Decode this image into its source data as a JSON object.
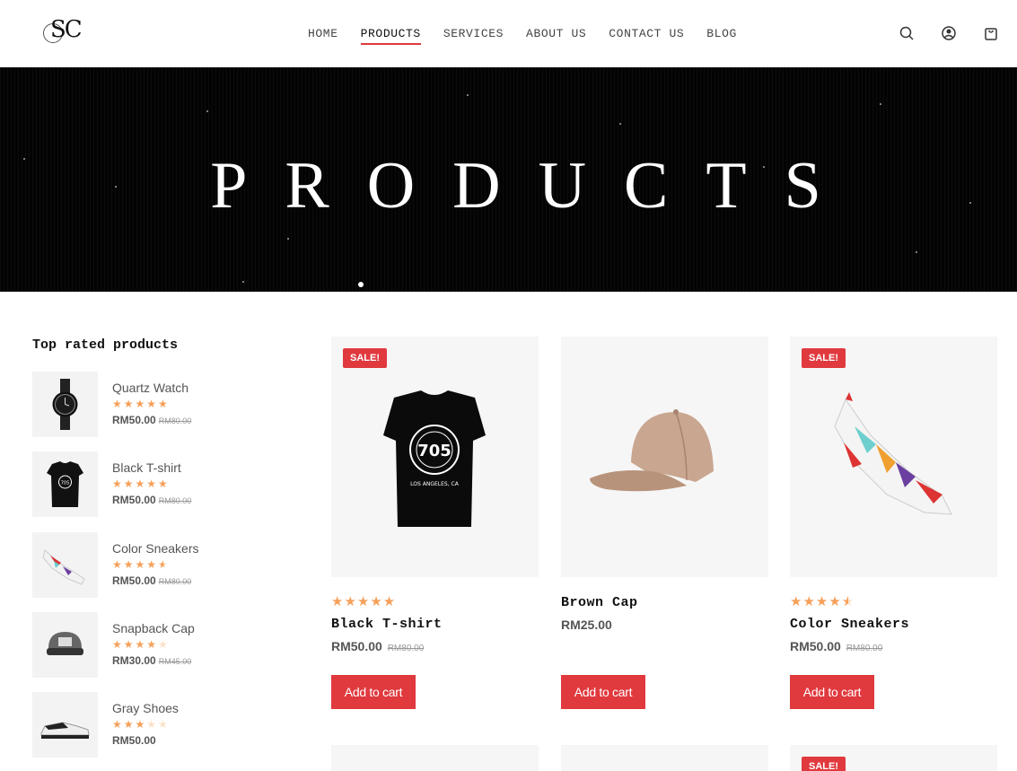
{
  "brand": {
    "logo_text": "SC"
  },
  "nav": {
    "items": [
      {
        "label": "HOME"
      },
      {
        "label": "PRODUCTS",
        "active": true
      },
      {
        "label": "SERVICES"
      },
      {
        "label": "ABOUT US"
      },
      {
        "label": "CONTACT US"
      },
      {
        "label": "BLOG"
      }
    ]
  },
  "header_icons": [
    "search-icon",
    "account-icon",
    "cart-icon"
  ],
  "hero": {
    "title": "PRODUCTS"
  },
  "sidebar": {
    "title": "Top rated products",
    "items": [
      {
        "name": "Quartz Watch",
        "rating": 5,
        "price": "RM50.00",
        "old_price": "RM80.00"
      },
      {
        "name": "Black T-shirt",
        "rating": 5,
        "price": "RM50.00",
        "old_price": "RM80.00"
      },
      {
        "name": "Color Sneakers",
        "rating": 4.5,
        "price": "RM50.00",
        "old_price": "RM80.00"
      },
      {
        "name": "Snapback Cap",
        "rating": 4,
        "price": "RM30.00",
        "old_price": "RM45.00"
      },
      {
        "name": "Gray Shoes",
        "rating": 3,
        "price": "RM50.00",
        "old_price": ""
      }
    ]
  },
  "products": [
    {
      "name": "Black T-shirt",
      "sale_badge": "SALE!",
      "rating": 5,
      "price": "RM50.00",
      "old_price": "RM80.00",
      "button": "Add to cart"
    },
    {
      "name": "Brown Cap",
      "sale_badge": "",
      "rating": 0,
      "price": "RM25.00",
      "old_price": "",
      "button": "Add to cart"
    },
    {
      "name": "Color Sneakers",
      "sale_badge": "SALE!",
      "rating": 4.5,
      "price": "RM50.00",
      "old_price": "RM80.00",
      "button": "Add to cart"
    }
  ],
  "next_row": {
    "sale_badge": "SALE!"
  },
  "colors": {
    "accent": "#e0393e",
    "star": "#f5a05a",
    "star_empty": "#fbe1c8",
    "card_bg": "#f6f6f6"
  }
}
